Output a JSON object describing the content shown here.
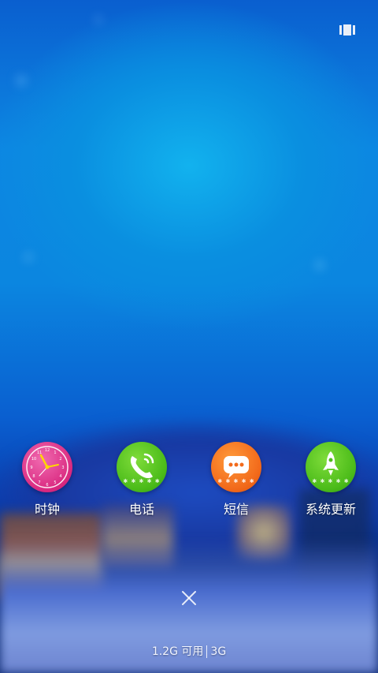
{
  "recents": {
    "icon": "recents-icon"
  },
  "apps": [
    {
      "label": "时钟",
      "icon": "clock-icon",
      "color": "#e0338d"
    },
    {
      "label": "电话",
      "icon": "phone-icon",
      "color": "#4cbc1a"
    },
    {
      "label": "短信",
      "icon": "message-icon",
      "color": "#f26a1b"
    },
    {
      "label": "系统更新",
      "icon": "rocket-icon",
      "color": "#4cbc1a"
    }
  ],
  "close": {
    "icon": "close-icon"
  },
  "memory": {
    "available": "1.2G 可用",
    "network": "3G"
  }
}
